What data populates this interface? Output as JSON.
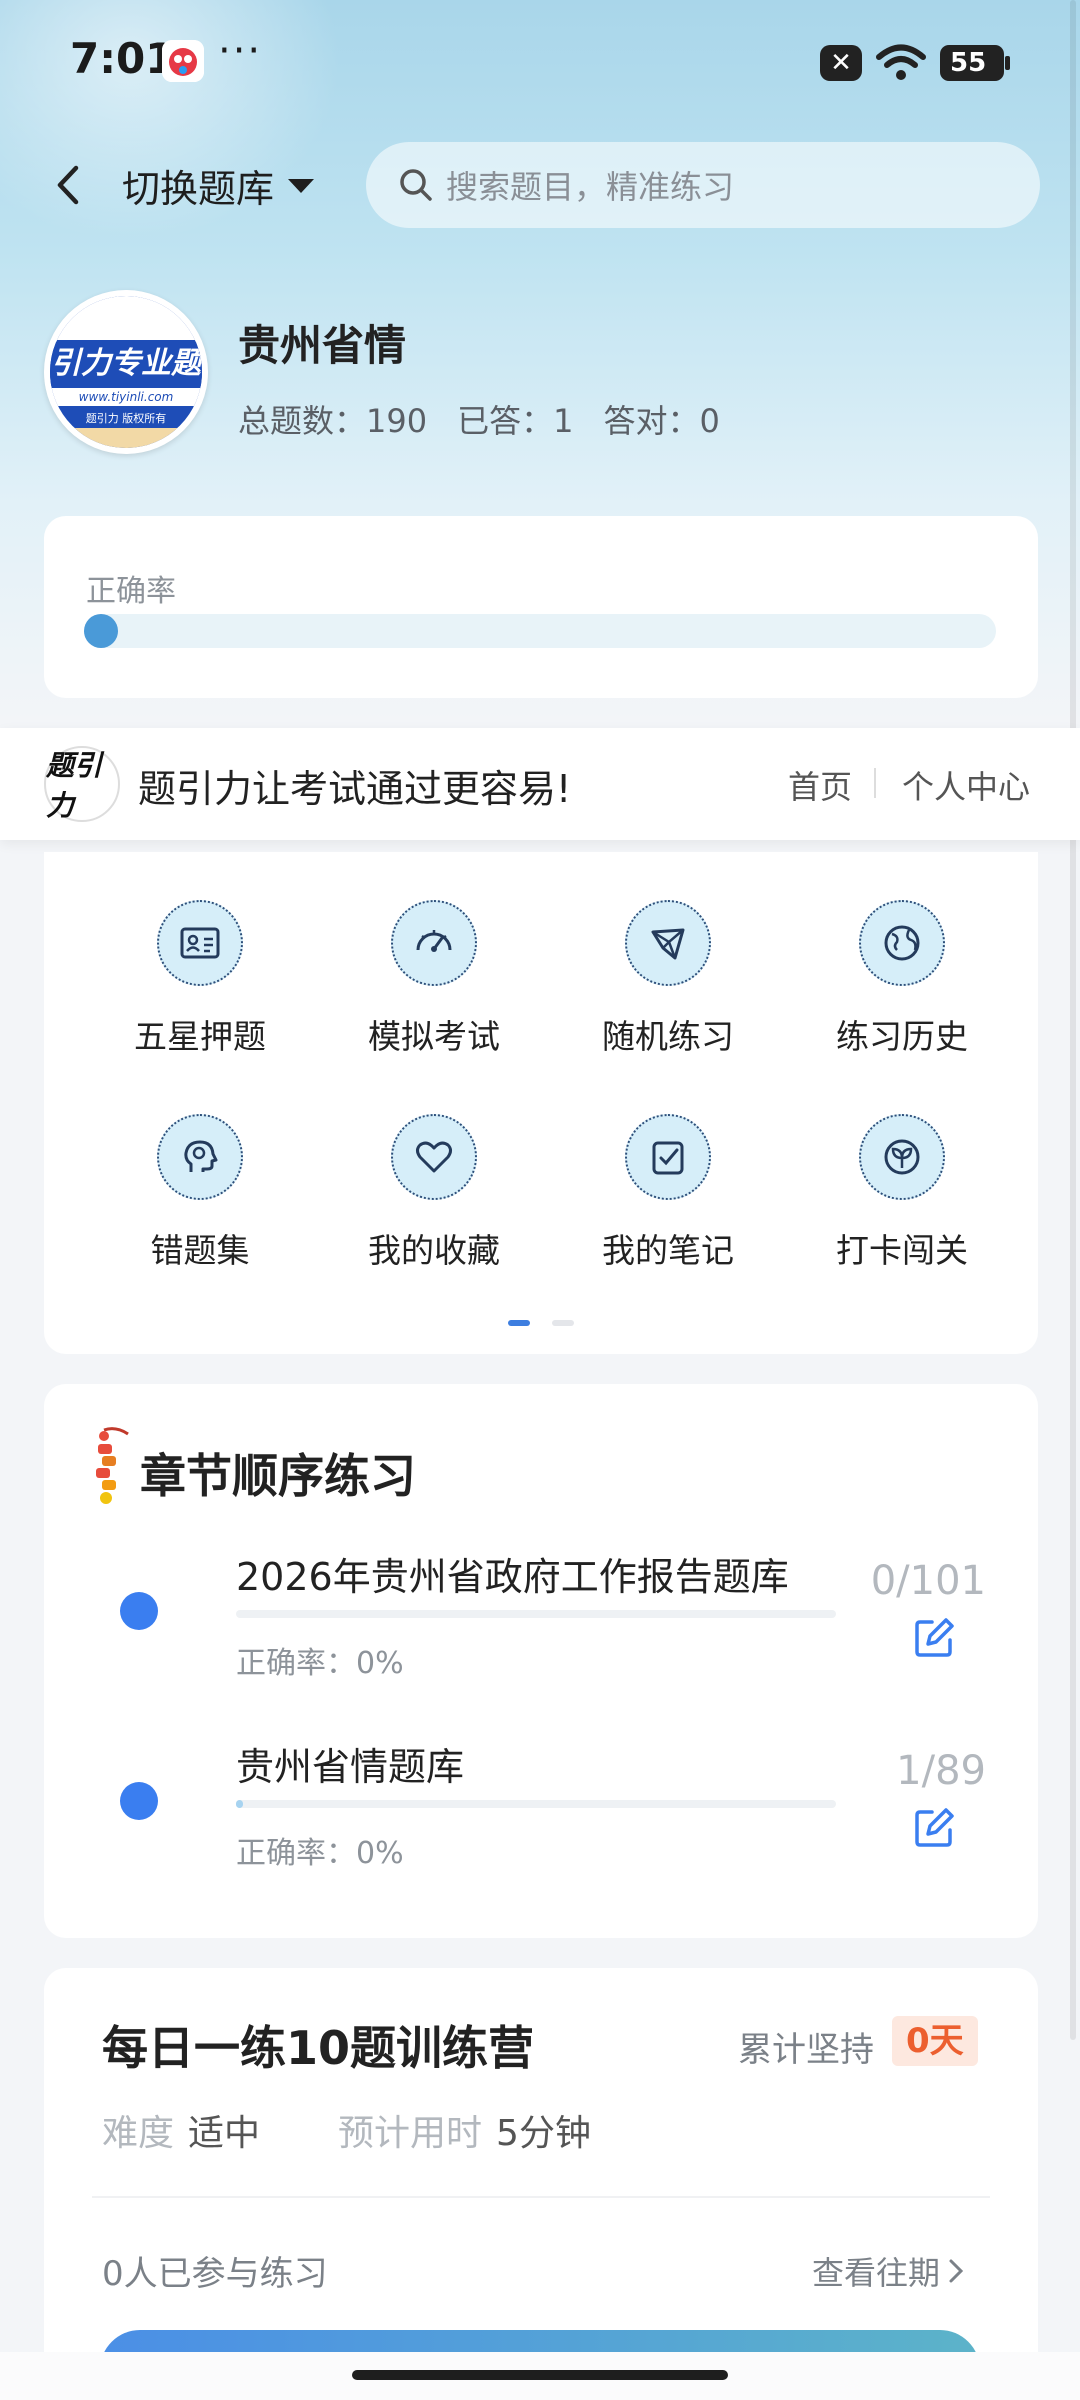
{
  "status_bar": {
    "time": "7:01",
    "dots": "···",
    "sim": "✕",
    "battery": "55"
  },
  "header": {
    "switch_label": "切换题库",
    "search_placeholder": "搜索题目，精准练习"
  },
  "bank": {
    "logo_text": "引力专业题",
    "logo_url": "www.tiyinli.com",
    "logo_copyright": "题引力 版权所有",
    "title": "贵州省情",
    "total": "总题数：190",
    "answered": "已答：1",
    "correct": "答对：0"
  },
  "accuracy": {
    "label": "正确率",
    "value": 0.0
  },
  "banner": {
    "logo_text": "题引力",
    "slogan": "题引力让考试通过更容易!",
    "home": "首页",
    "personal": "个人中心"
  },
  "features": [
    {
      "label": "五星押题",
      "icon": "id-card-icon"
    },
    {
      "label": "模拟考试",
      "icon": "speedometer-icon"
    },
    {
      "label": "随机练习",
      "icon": "shuffle-icon"
    },
    {
      "label": "练习历史",
      "icon": "globe-icon"
    },
    {
      "label": "错题集",
      "icon": "head-icon"
    },
    {
      "label": "我的收藏",
      "icon": "heart-icon"
    },
    {
      "label": "我的笔记",
      "icon": "note-check-icon"
    },
    {
      "label": "打卡闯关",
      "icon": "sprout-icon"
    }
  ],
  "chapters": {
    "title": "章节顺序练习",
    "items": [
      {
        "name": "2026年贵州省政府工作报告题库",
        "accuracy": "正确率：0%",
        "count": "0/101",
        "progress": 0.0
      },
      {
        "name": "贵州省情题库",
        "accuracy": "正确率：0%",
        "count": "1/89",
        "progress": 0.011
      }
    ]
  },
  "daily": {
    "title": "每日一练10题训练营",
    "persist_label": "累计坚持",
    "persist_value": "0天",
    "difficulty_label": "难度",
    "difficulty_value": "适中",
    "time_label": "预计用时",
    "time_value": "5分钟",
    "joined": "0人已参与练习",
    "history": "查看往期"
  },
  "colors": {
    "accent": "#3a7ef0",
    "badge": "#ec5f2f"
  }
}
